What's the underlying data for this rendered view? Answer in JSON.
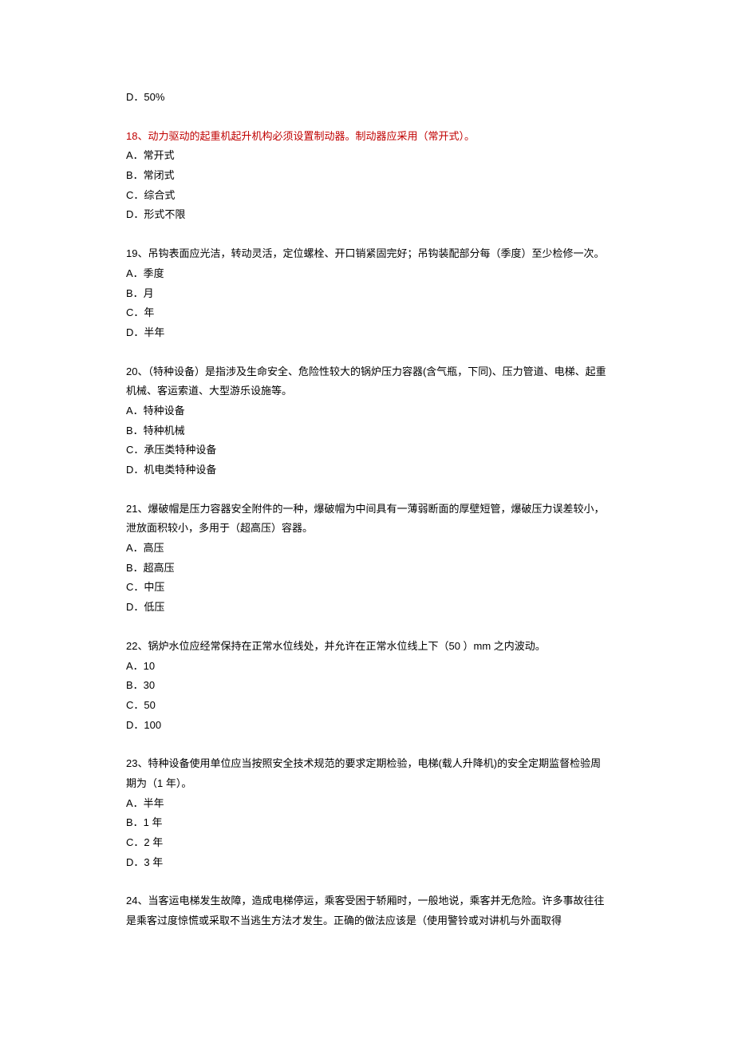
{
  "q17": {
    "optD": "D．50%"
  },
  "q18": {
    "text": "18、动力驱动的起重机起升机构必须设置制动器。制动器应采用（常开式）。",
    "optA": "A．常开式",
    "optB": "B．常闭式",
    "optC": "C．综合式",
    "optD": "D．形式不限"
  },
  "q19": {
    "text": "19、吊钩表面应光洁，转动灵活，定位螺栓、开口销紧固完好；吊钩装配部分每（季度）至少检修一次。",
    "optA": "A．季度",
    "optB": "B．月",
    "optC": "C．年",
    "optD": "D．半年"
  },
  "q20": {
    "text": "20、（特种设备）是指涉及生命安全、危险性较大的锅炉压力容器(含气瓶，下同)、压力管道、电梯、起重机械、客运索道、大型游乐设施等。",
    "optA": "A．特种设备",
    "optB": "B．特种机械",
    "optC": "C．承压类特种设备",
    "optD": "D．机电类特种设备"
  },
  "q21": {
    "text": "21、爆破帽是压力容器安全附件的一种，爆破帽为中间具有一薄弱断面的厚壁短管，爆破压力误差较小，泄放面积较小，多用于（超高压）容器。",
    "optA": "A．高压",
    "optB": "B．超高压",
    "optC": "C．中压",
    "optD": "D．低压"
  },
  "q22": {
    "text": "22、锅炉水位应经常保持在正常水位线处，并允许在正常水位线上下（50 ）mm 之内波动。",
    "optA": "A．10",
    "optB": "B．30",
    "optC": "C．50",
    "optD": "D．100"
  },
  "q23": {
    "text": "23、特种设备使用单位应当按照安全技术规范的要求定期检验，电梯(载人升降机)的安全定期监督检验周期为（1 年）。",
    "optA": "A．半年",
    "optB": "B．1 年",
    "optC": "C．2 年",
    "optD": "D．3 年"
  },
  "q24": {
    "text": "24、当客运电梯发生故障，造成电梯停运，乘客受困于轿厢时，一般地说，乘客并无危险。许多事故往往是乘客过度惊慌或采取不当逃生方法才发生。正确的做法应该是（使用警铃或对讲机与外面取得"
  }
}
